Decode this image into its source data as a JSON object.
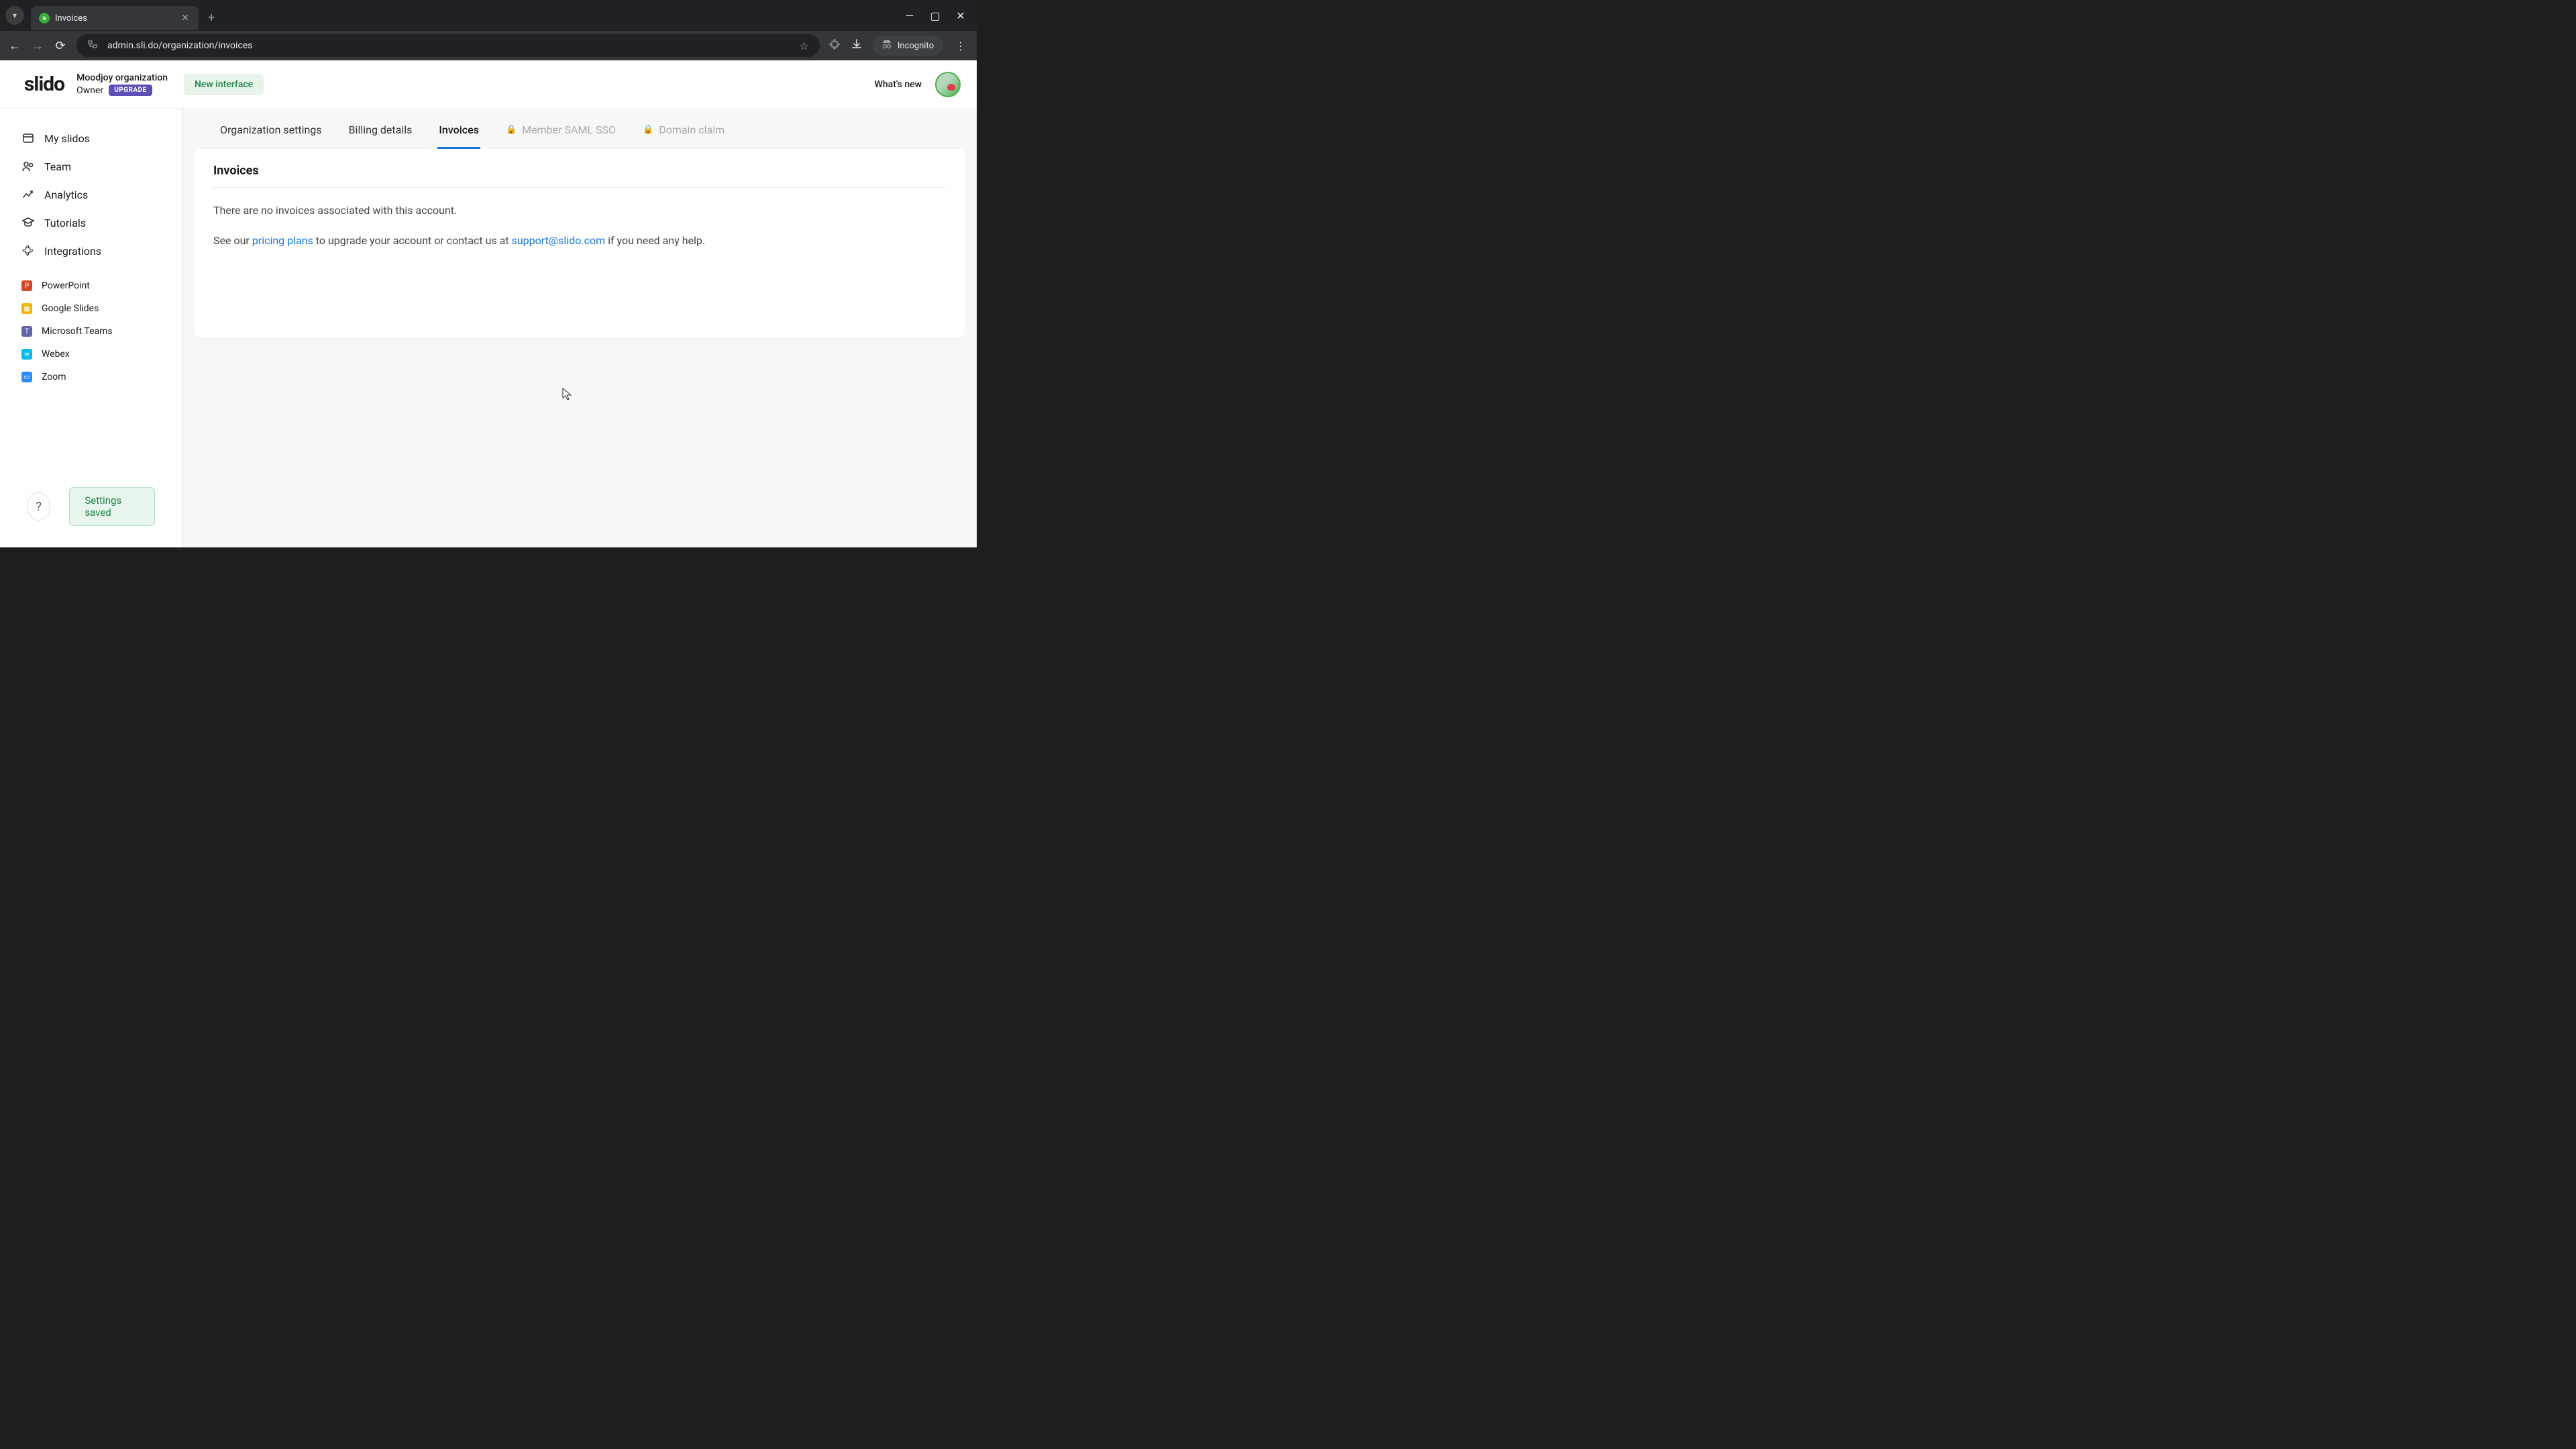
{
  "browser": {
    "tab_title": "Invoices",
    "url": "admin.sli.do/organization/invoices",
    "incognito_label": "Incognito"
  },
  "header": {
    "logo": "slido",
    "org_name": "Moodjoy organization",
    "owner_label": "Owner",
    "upgrade_label": "UPGRADE",
    "new_interface_label": "New interface",
    "whats_new": "What's new"
  },
  "sidebar": {
    "nav": {
      "my_slidos": "My slidos",
      "team": "Team",
      "analytics": "Analytics",
      "tutorials": "Tutorials",
      "integrations": "Integrations"
    },
    "integrations": {
      "powerpoint": "PowerPoint",
      "google_slides": "Google Slides",
      "ms_teams": "Microsoft Teams",
      "webex": "Webex",
      "zoom": "Zoom"
    },
    "help_label": "?",
    "toast": "Settings saved"
  },
  "tabs": {
    "org_settings": "Organization settings",
    "billing": "Billing details",
    "invoices": "Invoices",
    "saml_sso": "Member SAML SSO",
    "domain_claim": "Domain claim"
  },
  "content": {
    "title": "Invoices",
    "empty": "There are no invoices associated with this account.",
    "cta_prefix": "See our ",
    "pricing_link": "pricing plans",
    "cta_mid": " to upgrade your account or contact us at ",
    "support_link": "support@slido.com",
    "cta_suffix": " if you need any help."
  }
}
